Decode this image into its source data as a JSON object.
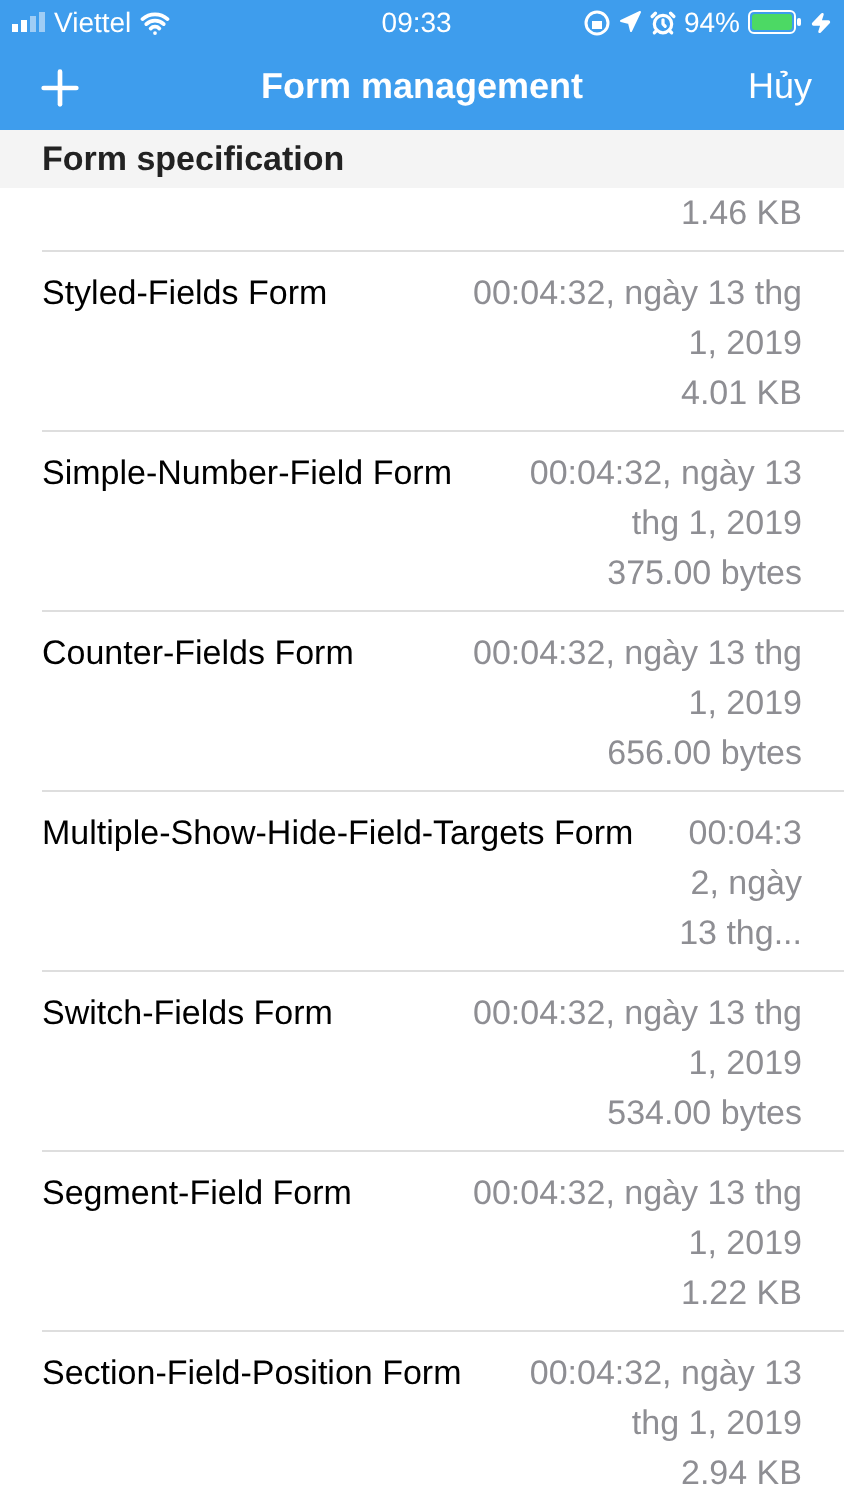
{
  "status_bar": {
    "carrier": "Viettel",
    "time": "09:33",
    "battery": "94%"
  },
  "nav_bar": {
    "title": "Form management",
    "cancel": "Hủy"
  },
  "section": {
    "title": "Form specification"
  },
  "rows": [
    {
      "detail_lines": [
        "1.46 KB"
      ]
    },
    {
      "title": "Styled-Fields Form",
      "detail_lines": [
        "00:04:32, ngày 13 thg",
        "1, 2019",
        "4.01 KB"
      ]
    },
    {
      "title": "Simple-Number-Field Form",
      "detail_lines": [
        "00:04:32, ngày 13",
        "thg 1, 2019",
        "375.00 bytes"
      ]
    },
    {
      "title": "Counter-Fields Form",
      "detail_lines": [
        "00:04:32, ngày 13 thg",
        "1, 2019",
        "656.00 bytes"
      ]
    },
    {
      "title": "Multiple-Show-Hide-Field-Targets Form",
      "detail_lines": [
        "00:04:3",
        "2, ngày",
        "13 thg..."
      ]
    },
    {
      "title": "Switch-Fields Form",
      "detail_lines": [
        "00:04:32, ngày 13 thg",
        "1, 2019",
        "534.00 bytes"
      ]
    },
    {
      "title": "Segment-Field Form",
      "detail_lines": [
        "00:04:32, ngày 13 thg",
        "1, 2019",
        "1.22 KB"
      ]
    },
    {
      "title": "Section-Field-Position Form",
      "detail_lines": [
        "00:04:32, ngày 13",
        "thg 1, 2019",
        "2.94 KB"
      ]
    }
  ]
}
